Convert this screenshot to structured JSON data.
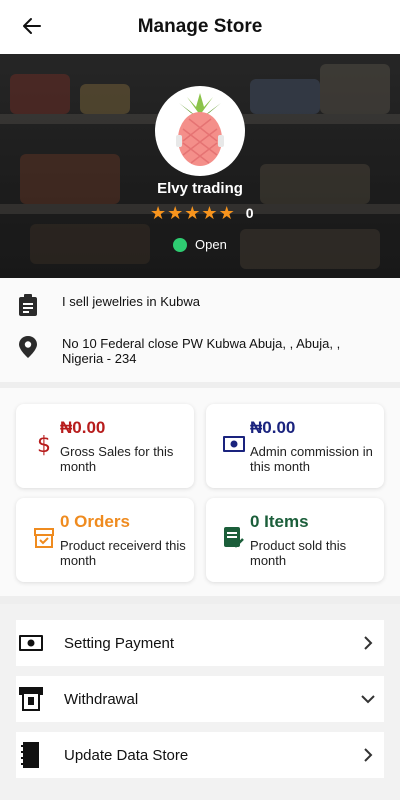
{
  "header": {
    "title": "Manage Store"
  },
  "store": {
    "name": "Elvy trading",
    "rating_count": "0",
    "stars": 5,
    "status": "Open",
    "status_color": "#2ecc71",
    "description": "I sell jewelries in Kubwa",
    "address": "No 10 Federal close PW Kubwa Abuja, , Abuja, , Nigeria - 234"
  },
  "stats": [
    {
      "value": "₦0.00",
      "label": "Gross Sales for this month",
      "color": "#b71c1c",
      "icon": "dollar-icon"
    },
    {
      "value": "₦0.00",
      "label": "Admin commission in this month",
      "color": "#1a237e",
      "icon": "cash-icon"
    },
    {
      "value": "0 Orders",
      "label": "Product receiverd this month",
      "color": "#ef8b1f",
      "icon": "order-icon"
    },
    {
      "value": "0 Items",
      "label": "Product sold this month",
      "color": "#1b5e3a",
      "icon": "sold-icon"
    }
  ],
  "menu": [
    {
      "label": "Setting Payment",
      "icon": "payment-icon",
      "chevron": "chevron-right"
    },
    {
      "label": "Withdrawal",
      "icon": "withdrawal-icon",
      "chevron": "chevron-down"
    },
    {
      "label": "Update Data Store",
      "icon": "store-data-icon",
      "chevron": "chevron-right"
    }
  ]
}
